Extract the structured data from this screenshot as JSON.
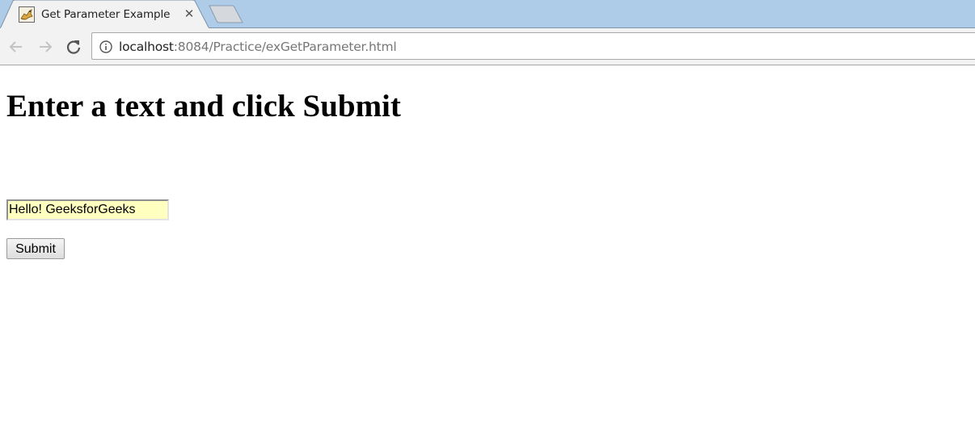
{
  "browser": {
    "tab": {
      "title": "Get Parameter Example",
      "favicon": "tomcat-icon",
      "close_glyph": "✕"
    },
    "new_tab": "new-tab-button",
    "toolbar": {
      "back_icon": "arrow-left-icon",
      "forward_icon": "arrow-right-icon",
      "reload_icon": "reload-icon"
    },
    "address_bar": {
      "security_icon": "info-icon",
      "host": "localhost",
      "path": ":8084/Practice/exGetParameter.html"
    }
  },
  "page": {
    "heading": "Enter a text and click Submit",
    "text_input": {
      "value": "Hello! GeeksforGeeks"
    },
    "submit_label": "Submit"
  },
  "colors": {
    "tabstrip_bg": "#aecbe8",
    "input_autofill_bg": "#ffffc0"
  }
}
